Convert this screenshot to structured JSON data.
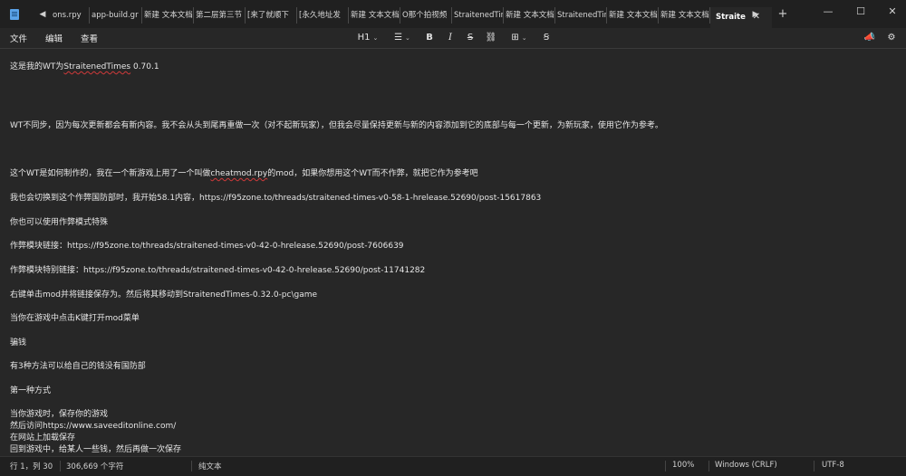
{
  "tabs": [
    {
      "label": "ons.rpy",
      "w": 56
    },
    {
      "label": "app-build.gr",
      "w": 57
    },
    {
      "label": "新建 文本文档",
      "w": 57
    },
    {
      "label": "第二层第三节",
      "w": 57
    },
    {
      "label": "[来了就顺下",
      "w": 57
    },
    {
      "label": "[永久地址发",
      "w": 57
    },
    {
      "label": "新建 文本文档",
      "w": 57
    },
    {
      "label": "O那个拍视频",
      "w": 57
    },
    {
      "label": "StraitenedTin",
      "w": 57
    },
    {
      "label": "新建 文本文档",
      "w": 57
    },
    {
      "label": "StraitenedTin",
      "w": 57
    },
    {
      "label": "新建 文本文档",
      "w": 57
    },
    {
      "label": "新建 文本文档",
      "w": 57
    }
  ],
  "active_tab": "Straite",
  "menu": {
    "file": "文件",
    "edit": "编辑",
    "view": "查看"
  },
  "toolbar": {
    "heading": "H1",
    "bold": "B",
    "italic": "I",
    "strike": "S"
  },
  "content": {
    "line1_pre": "这是我的WT为",
    "line1_link": "StraitenedTimes",
    "line1_post": " 0.70.1",
    "line2": "WT不同步，因为每次更新都会有新内容。我不会从头到尾再重做一次（对不起新玩家），但我会尽量保持更新与新的内容添加到它的底部与每一个更新，为新玩家，使用它作为参考。",
    "line3_pre": "这个WT是如何制作的，我在一个新游戏上用了一个叫做",
    "line3_mod": "cheatmod.rpy",
    "line3_post": "的mod，如果你想用这个WT而不作弊，就把它作为参考吧",
    "line4": "我也会切换到这个作弊国防部时，我开始58.1内容，https://f95zone.to/threads/straitened-times-v0-58-1-hrelease.52690/post-15617863",
    "line5": "你也可以使用作弊模式特殊",
    "line6": "作弊模块链接：https://f95zone.to/threads/straitened-times-v0-42-0-hrelease.52690/post-7606639",
    "line7": "作弊模块特别链接：https://f95zone.to/threads/straitened-times-v0-42-0-hrelease.52690/post-11741282",
    "line8": "右键单击mod并将链接保存为。然后将其移动到StraitenedTimes-0.32.0-pc\\game",
    "line9": "当你在游戏中点击K键打开mod菜单",
    "line10": " 骗钱",
    "line11": "有3种方法可以给自己的钱没有国防部",
    "line12": "第一种方式",
    "line13": "当你游戏时，保存你的游戏",
    "line14": "然后访问https://www.saveeditonline.com/",
    "line15": "在网站上加载保存",
    "line16": "回到游戏中，给某人一些钱，然后再做一次保存"
  },
  "status": {
    "position": "行 1，列 30",
    "chars": "306,669 个字符",
    "format": "纯文本",
    "zoom": "100%",
    "eol": "Windows (CRLF)",
    "encoding": "UTF-8"
  }
}
